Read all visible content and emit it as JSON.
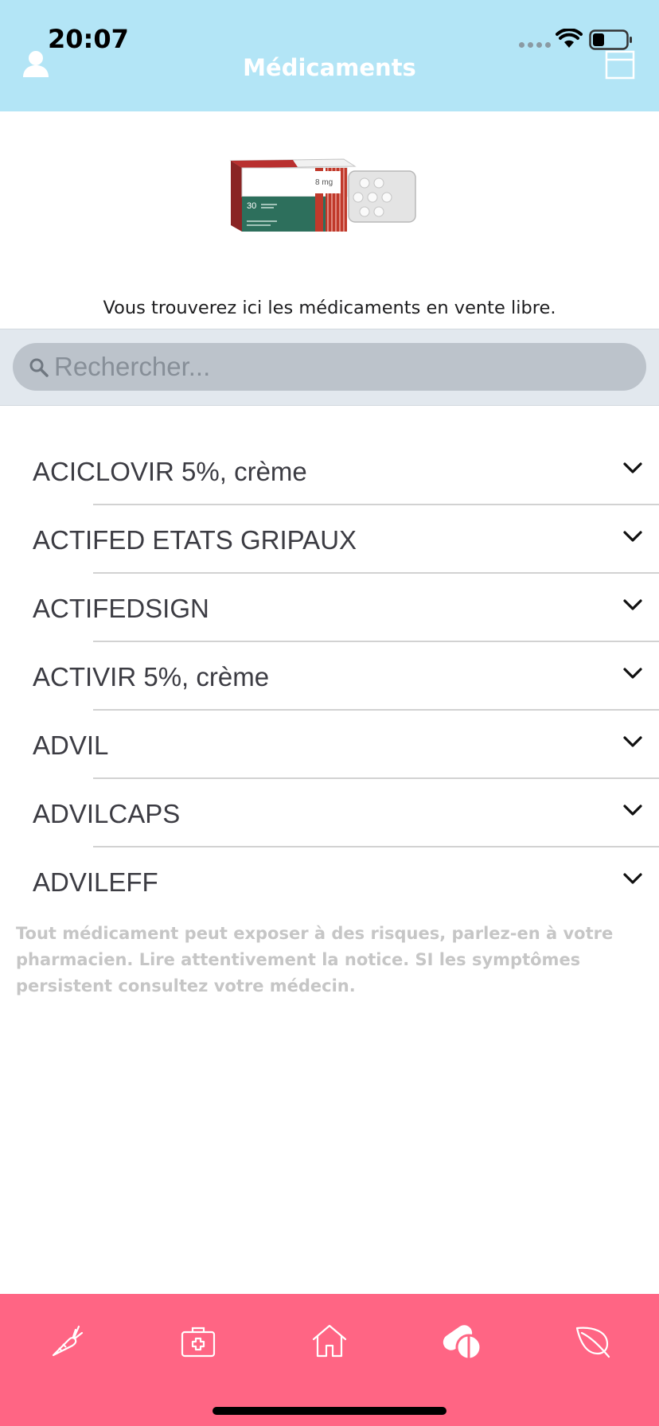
{
  "status_bar": {
    "time": "20:07"
  },
  "header": {
    "title": "Médicaments"
  },
  "intro": {
    "text": "Vous trouverez ici les médicaments en vente libre."
  },
  "illustration": {
    "dose_label": "8 mg",
    "count_label": "30"
  },
  "search": {
    "placeholder": "Rechercher...",
    "value": ""
  },
  "medications": [
    {
      "label": "ACICLOVIR 5%, crème"
    },
    {
      "label": "ACTIFED ETATS GRIPAUX"
    },
    {
      "label": "ACTIFEDSIGN"
    },
    {
      "label": "ACTIVIR 5%, crème"
    },
    {
      "label": "ADVIL"
    },
    {
      "label": "ADVILCAPS"
    },
    {
      "label": "ADVILEFF"
    }
  ],
  "disclaimer": {
    "text": "Tout médicament peut exposer à des risques, parlez-en à votre pharmacien. Lire attentivement la notice. SI les symptômes persistent consultez votre médecin."
  },
  "tab_bar": {
    "tabs": [
      {
        "icon": "carrot-icon"
      },
      {
        "icon": "first-aid-kit-icon"
      },
      {
        "icon": "home-icon"
      },
      {
        "icon": "pills-icon",
        "active": true
      },
      {
        "icon": "leaf-icon"
      }
    ]
  },
  "colors": {
    "header_bg": "#b3e5f6",
    "tab_bar_bg": "#ff6584",
    "search_bar_bg": "#e2e8ee",
    "search_field_bg": "#bcc3cb"
  }
}
